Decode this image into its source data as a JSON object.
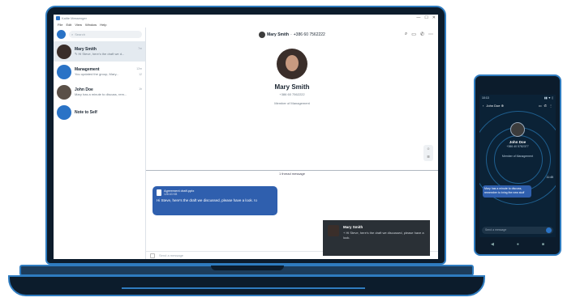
{
  "window": {
    "title": "Kalite Messenger",
    "controls": [
      "—",
      "☐",
      "✕"
    ]
  },
  "menubar": [
    "File",
    "Edit",
    "View",
    "Window",
    "Help"
  ],
  "sidebar": {
    "search_placeholder": "Search",
    "chats": [
      {
        "name": "Mary Smith",
        "preview": "✎ Hi Steve, here's the draft we d...",
        "time": "7m",
        "unread": ""
      },
      {
        "name": "Management",
        "preview": "You updated the group, Mary...",
        "time": "12m",
        "unread": "12"
      },
      {
        "name": "John Doe",
        "preview": "Mary has a minute to discuss, rem...",
        "time": "1h",
        "unread": ""
      },
      {
        "name": "Note to Self",
        "preview": "",
        "time": "",
        "unread": ""
      }
    ]
  },
  "conversation": {
    "header_name": "Mary Smith",
    "header_phone": "+386 60 7562222",
    "profile_name": "Mary Smith",
    "profile_phone": "+386 60 7562222",
    "profile_role": "Member of Management",
    "thread_label": "1 thread message",
    "message": {
      "file_name": "Agreement draft.pptx",
      "file_size": "128.63 KB",
      "text": "Hi Steve, here's the draft we discussed, please have a look. !o"
    },
    "composer_placeholder": "Send a message"
  },
  "toast": {
    "name": "Mary Smith",
    "text": "+ Hi Steve, here's the draft we discussed, please have a look."
  },
  "phone": {
    "status_time": "10:13",
    "status_icons": "▮▮ ▼ ▯",
    "header_name": "John Doe ⊕",
    "name": "John Doe",
    "phone": "+386 40 5782377",
    "role": "Member of Management",
    "divider_time": "11:45",
    "bubble_text": "Mary has a minute to discuss, remember to bring the new stuff",
    "composer_placeholder": "Send a message"
  },
  "colors": {
    "accent": "#2f5fae",
    "frame_outline": "#2f7cc0",
    "frame_fill": "#0c1c2c"
  }
}
